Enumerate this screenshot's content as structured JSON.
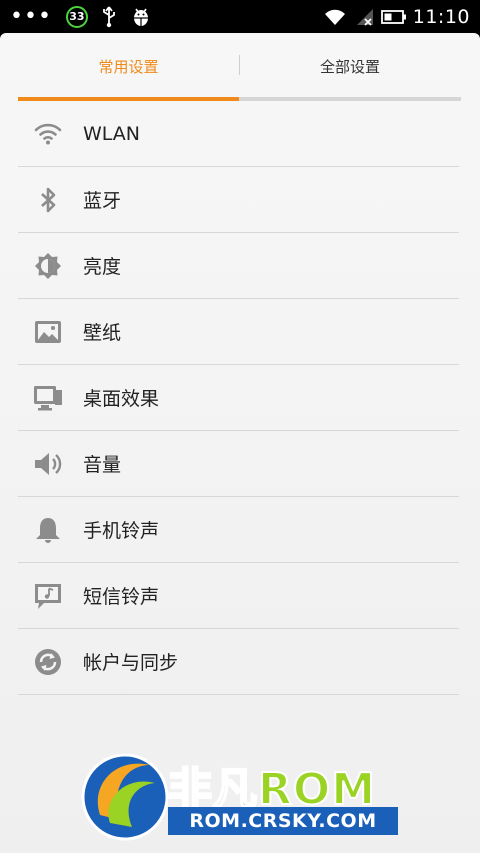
{
  "status_bar": {
    "badge_count": "33",
    "time": "11:10"
  },
  "tabs": [
    {
      "label": "常用设置",
      "active": true
    },
    {
      "label": "全部设置",
      "active": false
    }
  ],
  "settings": [
    {
      "label": "WLAN",
      "icon": "wifi-icon"
    },
    {
      "label": "蓝牙",
      "icon": "bluetooth-icon"
    },
    {
      "label": "亮度",
      "icon": "brightness-icon"
    },
    {
      "label": "壁纸",
      "icon": "wallpaper-icon"
    },
    {
      "label": "桌面效果",
      "icon": "desktop-effect-icon"
    },
    {
      "label": "音量",
      "icon": "volume-icon"
    },
    {
      "label": "手机铃声",
      "icon": "bell-icon"
    },
    {
      "label": "短信铃声",
      "icon": "message-tone-icon"
    },
    {
      "label": "帐户与同步",
      "icon": "sync-icon"
    }
  ],
  "watermark": {
    "brand_cn": "非凡",
    "brand_rom": "ROM",
    "url": "ROM.CRSKY.COM"
  },
  "colors": {
    "accent": "#f08a1a",
    "text": "#222222",
    "icon": "#8c8c8c",
    "divider": "#d7d7d7"
  }
}
